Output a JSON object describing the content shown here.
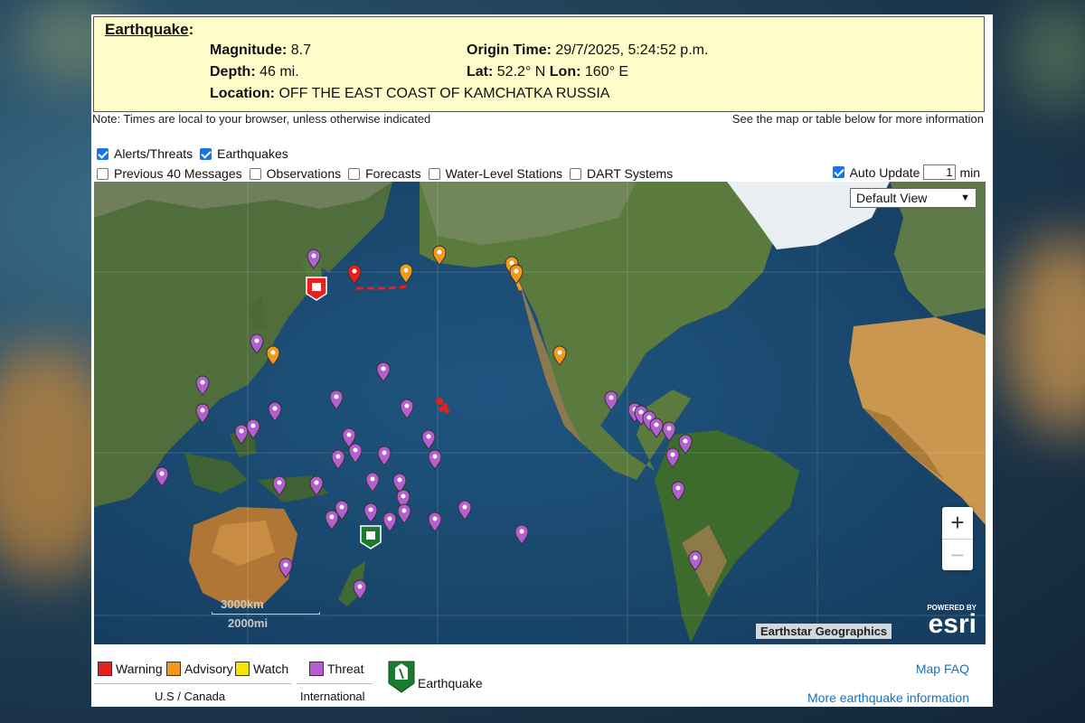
{
  "info": {
    "title": "Earthquake",
    "magnitude_label": "Magnitude:",
    "magnitude": "8.7",
    "depth_label": "Depth:",
    "depth": "46 mi.",
    "location_label": "Location:",
    "location": "OFF THE EAST COAST OF KAMCHATKA RUSSIA",
    "origin_label": "Origin Time:",
    "origin_time": "29/7/2025, 5:24:52 p.m.",
    "lat_label": "Lat:",
    "lat": "52.2° N",
    "lon_label": "Lon:",
    "lon": "160° E"
  },
  "notes": {
    "left": "Note: Times are local to your browser, unless otherwise indicated",
    "right": "See the map or table below for more information"
  },
  "layers": {
    "alerts": "Alerts/Threats",
    "earthquakes": "Earthquakes",
    "previous": "Previous 40 Messages",
    "observations": "Observations",
    "forecasts": "Forecasts",
    "water": "Water-Level Stations",
    "dart": "DART Systems",
    "auto_update": "Auto Update",
    "auto_value": "1",
    "auto_unit": "min"
  },
  "map": {
    "view": "Default View",
    "zoom_in": "+",
    "zoom_out": "−",
    "scale_km": "3000km",
    "scale_mi": "2000mi",
    "attribution": "Earthstar Geographics",
    "powered_by": "POWERED BY",
    "esri": "esri"
  },
  "legend": {
    "warning": "Warning",
    "advisory": "Advisory",
    "watch": "Watch",
    "threat": "Threat",
    "earthquake": "Earthquake",
    "us_canada": "U.S / Canada",
    "international": "International",
    "faq": "Map FAQ",
    "more": "More earthquake information"
  },
  "colors": {
    "warning": "#e5201f",
    "advisory": "#f39a1d",
    "watch": "#f5e400",
    "threat": "#b35fd0",
    "epicenter": "#1a7a2e"
  }
}
